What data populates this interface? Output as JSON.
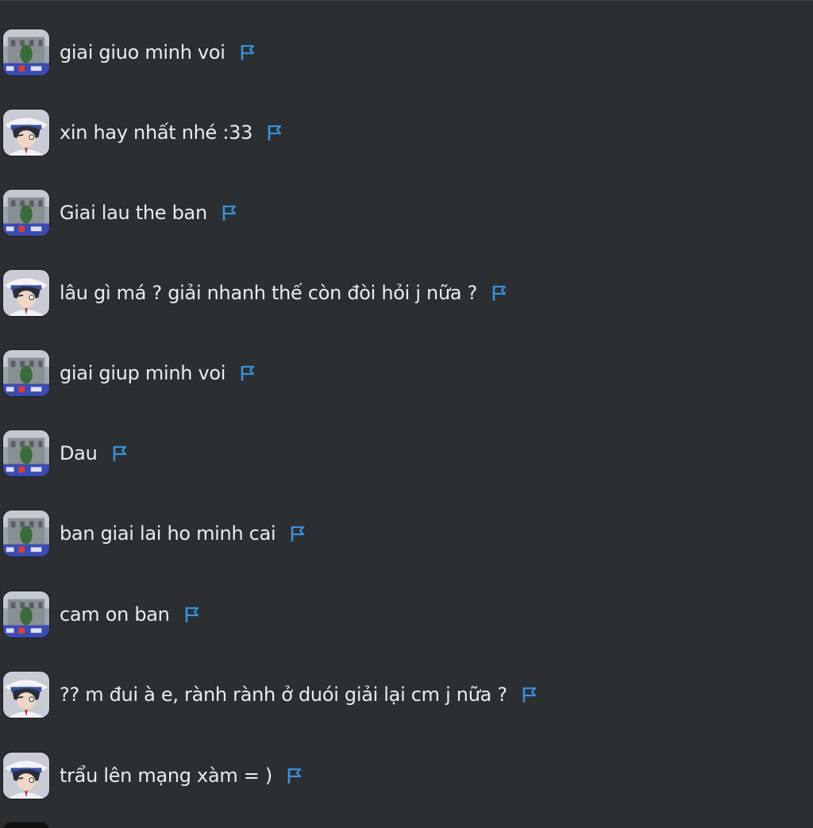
{
  "colors": {
    "background": "#2b2f32",
    "text": "#e9ecee",
    "flag": "#3a8fd9"
  },
  "messages": [
    {
      "text": "giai giuo minh voi",
      "avatar": "building-avatar",
      "flag_icon": "flag-icon"
    },
    {
      "text": "xin hay nhất nhé :33",
      "avatar": "character-avatar",
      "flag_icon": "flag-icon"
    },
    {
      "text": "Giai lau the ban",
      "avatar": "building-avatar",
      "flag_icon": "flag-icon"
    },
    {
      "text": "lâu gì má ? giải nhanh thế còn đòi hỏi j nữa ?",
      "avatar": "character-avatar",
      "flag_icon": "flag-icon"
    },
    {
      "text": "giai giup minh voi",
      "avatar": "building-avatar",
      "flag_icon": "flag-icon"
    },
    {
      "text": "Dau",
      "avatar": "building-avatar",
      "flag_icon": "flag-icon"
    },
    {
      "text": "ban giai lai ho minh cai",
      "avatar": "building-avatar",
      "flag_icon": "flag-icon"
    },
    {
      "text": "cam on ban",
      "avatar": "building-avatar",
      "flag_icon": "flag-icon"
    },
    {
      "text": "?? m đui à e, rành rành ở duói giải lại cm j nữa ?",
      "avatar": "character-avatar",
      "flag_icon": "flag-icon"
    },
    {
      "text": "trẩu lên mạng xàm = )",
      "avatar": "character-avatar",
      "flag_icon": "flag-icon"
    }
  ]
}
